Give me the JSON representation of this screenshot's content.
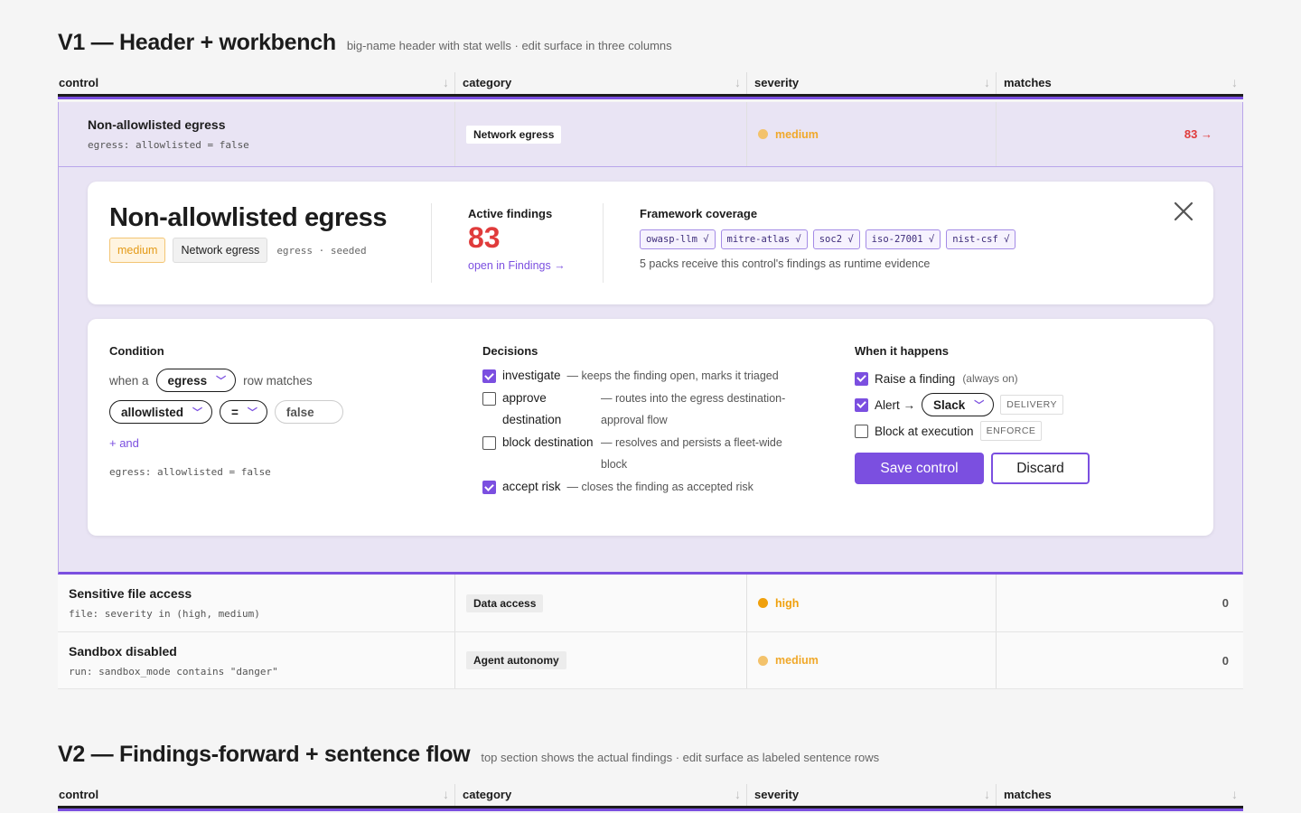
{
  "v1": {
    "title": "V1 — Header + workbench",
    "subtitle": "big-name header with stat wells · edit surface in three columns"
  },
  "columns": [
    "control",
    "category",
    "severity",
    "matches"
  ],
  "colors": {
    "accent": "#7b4fe0",
    "medium": "#f3c26b",
    "high": "#f0a00c",
    "danger": "#e03b3b"
  },
  "selected_row": {
    "name": "Non-allowlisted egress",
    "expr": "egress: allowlisted = false",
    "category": "Network egress",
    "severity": "medium",
    "matches": "83 →"
  },
  "detail": {
    "title": "Non-allowlisted egress",
    "severity": "medium",
    "category": "Network egress",
    "source": "egress · seeded",
    "active_label": "Active findings",
    "active_count": "83",
    "open_link": "open in Findings →",
    "framework_label": "Framework coverage",
    "packs": [
      "owasp-llm √",
      "mitre-atlas √",
      "soc2 √",
      "iso-27001 √",
      "nist-csf √"
    ],
    "framework_note": "5 packs receive this control's findings as runtime evidence",
    "close_icon": "close-icon"
  },
  "condition": {
    "heading": "Condition",
    "when_a": "when a",
    "entity": "egress",
    "row_matches": "row matches",
    "field": "allowlisted",
    "operator": "=",
    "value": "false",
    "add_and": "+ and",
    "expr": "egress: allowlisted = false"
  },
  "decisions": {
    "heading": "Decisions",
    "items": [
      {
        "name": "investigate",
        "desc": "— keeps the finding open, marks it triaged",
        "checked": true
      },
      {
        "name": "approve destination",
        "desc": "— routes into the egress destination-approval flow",
        "checked": false
      },
      {
        "name": "block destination",
        "desc": "— resolves and persists a fleet-wide block",
        "checked": false
      },
      {
        "name": "accept risk",
        "desc": "— closes the finding as accepted risk",
        "checked": true
      }
    ]
  },
  "when": {
    "heading": "When it happens",
    "raise": "Raise a finding",
    "raise_note": "(always on)",
    "alert": "Alert →",
    "alert_target": "Slack",
    "delivery_tag": "DELIVERY",
    "block": "Block at execution",
    "enforce_tag": "ENFORCE",
    "save": "Save control",
    "discard": "Discard"
  },
  "rows": [
    {
      "name": "Sensitive file access",
      "expr": "file: severity in (high, medium)",
      "category": "Data access",
      "severity": "high",
      "matches": "0"
    },
    {
      "name": "Sandbox disabled",
      "expr": "run: sandbox_mode contains \"danger\"",
      "category": "Agent autonomy",
      "severity": "medium",
      "matches": "0"
    }
  ],
  "v2": {
    "title": "V2 — Findings-forward + sentence flow",
    "subtitle": "top section shows the actual findings · edit surface as labeled sentence rows"
  }
}
